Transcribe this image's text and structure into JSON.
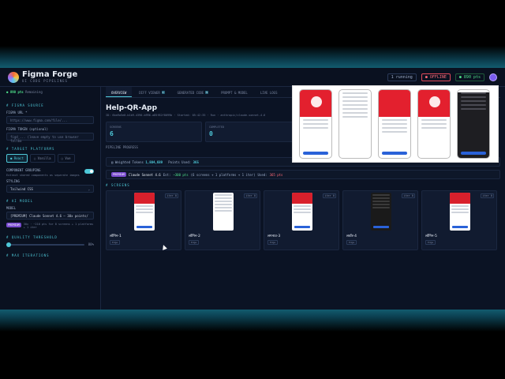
{
  "header": {
    "brand": "Figma Forge",
    "brand_sub": "UI   CODE   PIPELINES",
    "running": "1 running",
    "pill_red": "● OFFLINE",
    "points": "● 890 pts"
  },
  "sidebar": {
    "points_value": "● 890 pts",
    "points_label": "Remaining",
    "figma_source": "# FIGMA SOURCE",
    "figma_url_label": "FIGMA URL *",
    "figma_url_placeholder": "https://www.figma.com/file/...",
    "figma_token_label": "FIGMA TOKEN (optional)",
    "figma_token_placeholder": "figd_... (leave empty to use browser fallba",
    "target_platforms": "# TARGET PLATFORMS",
    "platforms": [
      "● React",
      "○ Vanilla",
      "○ Vue"
    ],
    "comp_label": "COMPONENT GROUPING",
    "comp_desc": "Extract shared components as separate images",
    "styling_label": "STYLING",
    "styling_value": "Tailwind CSS",
    "ai_model": "# AI MODEL",
    "model_label": "MODEL",
    "model_value": "[PREMIUM] Claude Sonnet 4.6 — 30x points/",
    "model_badge": "PREMIUM",
    "model_note": "30x · ~210 pts for 8 screens + 1 platforms + 1 iter",
    "quality_label": "# QUALITY THRESHOLD",
    "quality_value": "80%",
    "max_iter": "# MAX ITERATIONS"
  },
  "main": {
    "tabs": [
      {
        "label": "OVERVIEW",
        "count": ""
      },
      {
        "label": "DIFF VIEWER",
        "count": "1"
      },
      {
        "label": "GENERATED CODE",
        "count": "5"
      },
      {
        "label": "PROMPT & MODEL",
        "count": ""
      },
      {
        "label": "LIVE LOGS",
        "count": ""
      }
    ],
    "title": "Help-QR-App",
    "meta": "ID: 6ba9a5e0-b1b9-4390-b996-a85f82f8099b · Started: 05:42:35 · Run · anthropic/claude-sonnet-4.6",
    "stats": [
      {
        "k": "SCREENS",
        "v": "6"
      },
      {
        "k": "COMPLETED",
        "v": "0"
      }
    ],
    "pipeline_progress": "PIPELINE PROGRESS",
    "tokens_label": "Weighted Tokens",
    "tokens_value": "1,804,689",
    "points_used_label": "Points Used:",
    "points_used_value": "365",
    "model_badge": "PREMIUM",
    "model_name": "Claude Sonnet 4.6",
    "est_label": "Est:",
    "est_value": "~300 pts",
    "est_detail": "(6 screens + 1 platforms + 1 iter)",
    "used_label": "Used:",
    "used_value": "365 pts",
    "screens_label": "# SCREENS",
    "screens": [
      {
        "name": "लॉगिन-1",
        "tag": "Edge",
        "ver": "iter 0"
      },
      {
        "name": "लॉगिन-2",
        "tag": "Edge",
        "ver": "iter 0"
      },
      {
        "name": "लगनाउ-3",
        "tag": "Edge",
        "ver": "iter 0"
      },
      {
        "name": "लवॉर-4",
        "tag": "Edge",
        "ver": "iter 0"
      },
      {
        "name": "लॉगिन-5",
        "tag": "Edge",
        "ver": "iter 0"
      }
    ]
  },
  "colors": {
    "accent": "#4ec8d8",
    "red": "#e3202e",
    "green": "#4ee08a",
    "bg": "#0b1324"
  }
}
